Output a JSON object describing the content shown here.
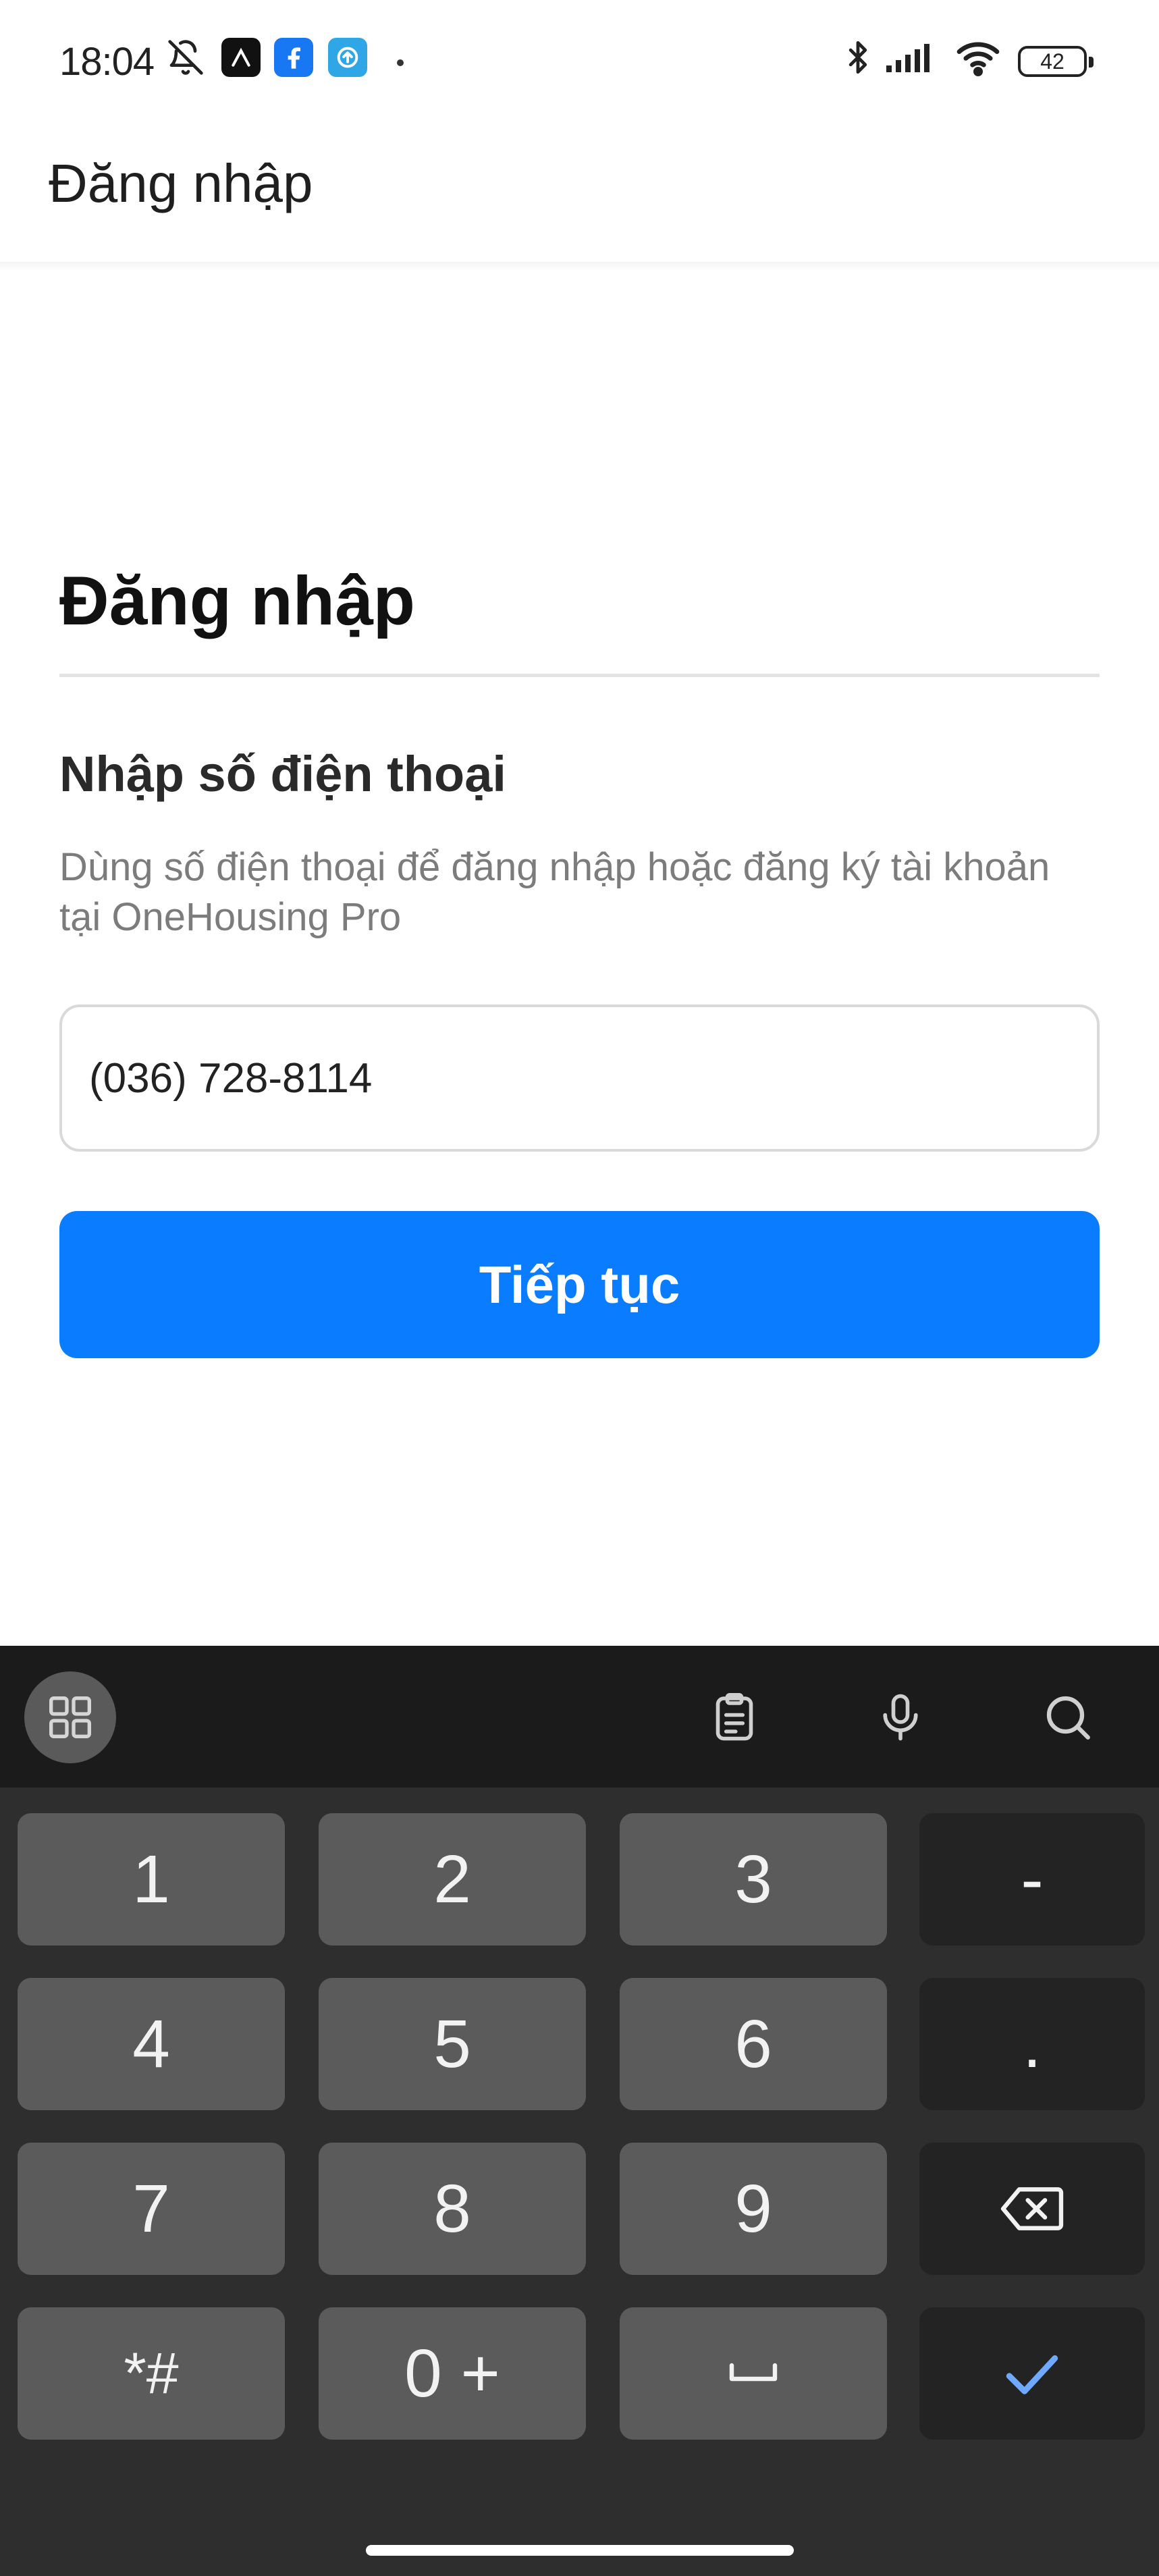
{
  "status_bar": {
    "time": "18:04",
    "icons": [
      "bell-off-icon",
      "app-icon",
      "facebook-icon",
      "upload-icon",
      "bluetooth-icon",
      "signal-icon",
      "wifi-icon"
    ],
    "battery_level": "42"
  },
  "app_bar": {
    "title": "Đăng nhập"
  },
  "main": {
    "heading": "Đăng nhập",
    "subheading": "Nhập số điện thoại",
    "description": "Dùng số điện thoại để đăng nhập hoặc đăng ký tài khoản tại OneHousing Pro",
    "phone_value": "(036) 728-8114",
    "continue_label": "Tiếp tục",
    "accent_color": "#0a7cff"
  },
  "keyboard": {
    "toolbar_icons": [
      "grid-icon",
      "clipboard-icon",
      "mic-icon",
      "search-icon"
    ],
    "keys": {
      "k1": "1",
      "k2": "2",
      "k3": "3",
      "minus": "-",
      "k4": "4",
      "k5": "5",
      "k6": "6",
      "dot": ".",
      "k7": "7",
      "k8": "8",
      "k9": "9",
      "symbols": "*#",
      "k0": "0 +"
    },
    "action_icons": [
      "backspace-icon",
      "space-icon",
      "check-icon"
    ]
  }
}
